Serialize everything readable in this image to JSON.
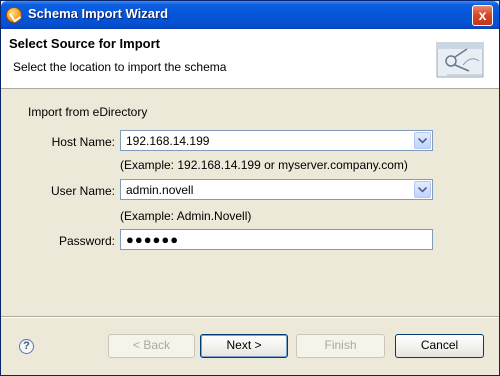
{
  "window": {
    "title": "Schema Import Wizard",
    "close_label": "x"
  },
  "header": {
    "title": "Select Source for Import",
    "description": "Select the location to import the schema"
  },
  "form": {
    "group_label": "Import from eDirectory",
    "host": {
      "label": "Host Name:",
      "value": "192.168.14.199",
      "example": "(Example: 192.168.14.199 or myserver.company.com)"
    },
    "user": {
      "label": "User Name:",
      "value": "admin.novell",
      "example": "(Example:  Admin.Novell)"
    },
    "password": {
      "label": "Password:",
      "value": "●●●●●●"
    }
  },
  "footer": {
    "help_label": "?",
    "back_label": "< Back",
    "next_label": "Next >",
    "finish_label": "Finish",
    "cancel_label": "Cancel"
  },
  "colors": {
    "titlebar": "#0654d8",
    "background": "#ece9d8",
    "field_border": "#7f9db9"
  }
}
